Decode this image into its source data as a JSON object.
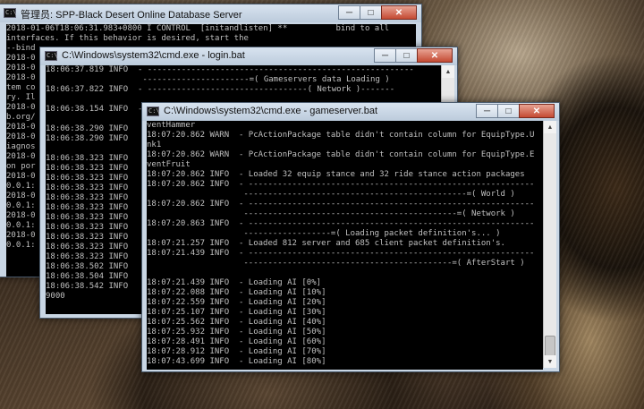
{
  "windows": {
    "server": {
      "title": "管理员:  SPP-Black Desert Online Database Server",
      "controls": {
        "minimize": "─",
        "maximize": "□",
        "close": "✕"
      },
      "lines": [
        "2018-01-06T18:06:31.983+0800 I CONTROL  [initandlisten] **          bind to all",
        "interfaces. If this behavior is desired, start the",
        "--bind",
        "2018-0",
        "2018-0",
        "2018-0",
        "tem co",
        "ry. Il",
        "2018-0",
        "b.org/",
        "2018-0",
        "2018-0",
        "iagnos",
        "2018-0",
        "on por",
        "2018-0",
        "0.0.1:",
        "2018-0",
        "0.0.1:",
        "2018-0",
        "0.0.1:",
        "2018-0",
        "0.0.1:"
      ]
    },
    "login": {
      "title": "C:\\Windows\\system32\\cmd.exe - login.bat",
      "controls": {
        "minimize": "─",
        "maximize": "□",
        "close": "✕"
      },
      "lines": [
        "18:06:37.819 INFO  - -------------------------------------------------------",
        "                    ----------------------=( Gameservers data Loading )",
        "18:06:37.822 INFO  - ---------------------------------( Network )-------",
        "",
        "18:06:38.154 INFO  - ----------------------------------------------------",
        "",
        "18:06:38.290 INFO",
        "18:06:38.290 INFO",
        "",
        "18:06:38.323 INFO",
        "18:06:38.323 INFO",
        "18:06:38.323 INFO",
        "18:06:38.323 INFO",
        "18:06:38.323 INFO",
        "18:06:38.323 INFO",
        "18:06:38.323 INFO",
        "18:06:38.323 INFO",
        "18:06:38.323 INFO",
        "18:06:38.323 INFO",
        "18:06:38.323 INFO",
        "18:06:38.502 INFO",
        "18:06:38.504 INFO",
        "18:06:38.542 INFO",
        "9000"
      ]
    },
    "game": {
      "title": "C:\\Windows\\system32\\cmd.exe - gameserver.bat",
      "controls": {
        "minimize": "─",
        "maximize": "□",
        "close": "✕"
      },
      "lines": [
        "ventHammer",
        "18:07:20.862 WARN  - PcActionPackage table didn't contain column for EquipType.U",
        "nk1",
        "18:07:20.862 WARN  - PcActionPackage table didn't contain column for EquipType.E",
        "ventFruit",
        "18:07:20.862 INFO  - Loaded 32 equip stance and 32 ride stance action packages",
        "18:07:20.862 INFO  - -----------------------------------------------------------",
        "                    ----------------------------------------------=( World )",
        "18:07:20.862 INFO  - -----------------------------------------------------------",
        "                    --------------------------------------------=( Network )",
        "18:07:20.863 INFO  - -----------------------------------------------------------",
        "                    ------------------=( Loading packet definition's... )",
        "18:07:21.257 INFO  - Loaded 812 server and 685 client packet definition's.",
        "18:07:21.439 INFO  - -----------------------------------------------------------",
        "                    -------------------------------------------=( AfterStart )",
        "",
        "18:07:21.439 INFO  - Loading AI [0%]",
        "18:07:22.088 INFO  - Loading AI [10%]",
        "18:07:22.559 INFO  - Loading AI [20%]",
        "18:07:25.107 INFO  - Loading AI [30%]",
        "18:07:25.562 INFO  - Loading AI [40%]",
        "18:07:25.932 INFO  - Loading AI [50%]",
        "18:07:28.491 INFO  - Loading AI [60%]",
        "18:07:28.912 INFO  - Loading AI [70%]",
        "18:07:43.699 INFO  - Loading AI [80%]"
      ]
    }
  }
}
